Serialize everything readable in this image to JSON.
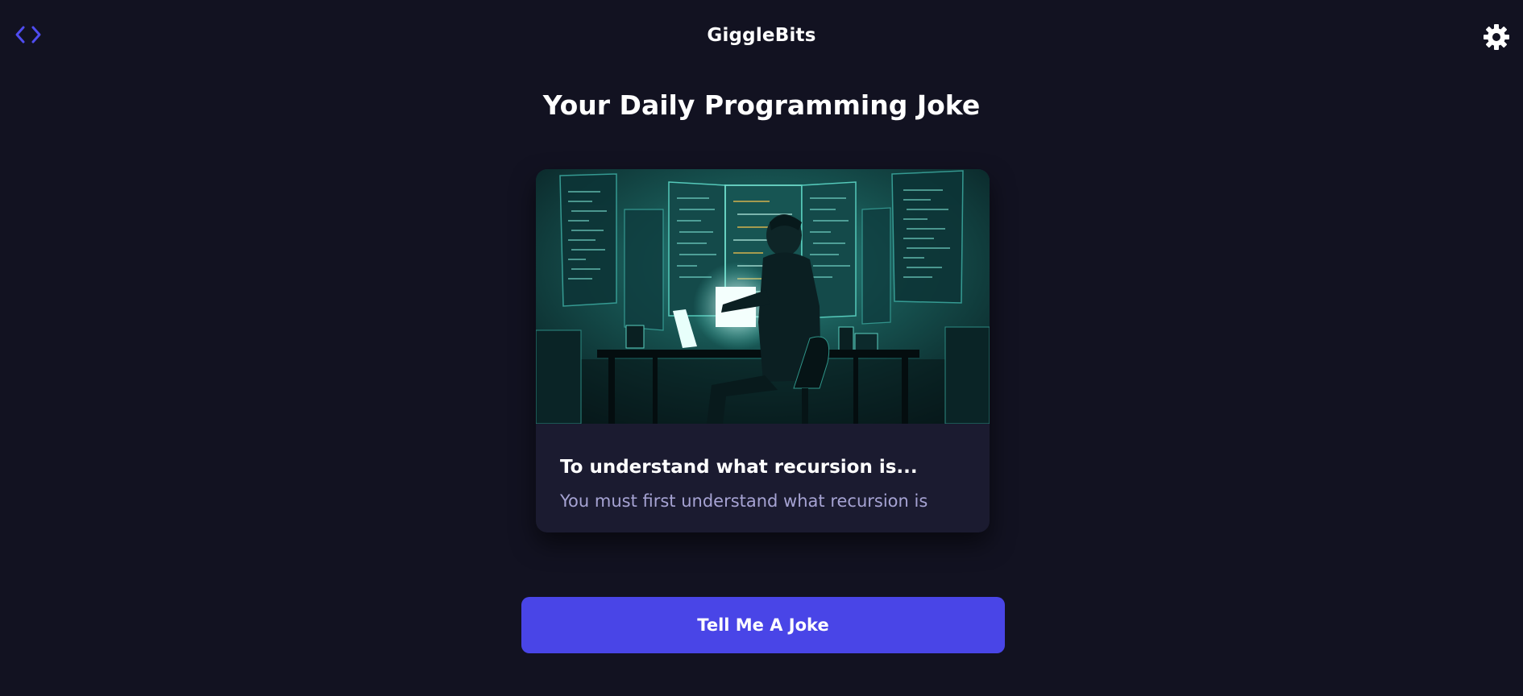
{
  "header": {
    "app_title": "GiggleBits",
    "left_icon": "code-icon",
    "right_icon": "gear-icon"
  },
  "page": {
    "title": "Your Daily Programming Joke"
  },
  "card": {
    "image_alt": "programmer at desk illustration",
    "setup": "To understand what recursion is...",
    "punchline": "You must first understand what recursion is"
  },
  "actions": {
    "joke_button_label": "Tell Me A Joke"
  },
  "colors": {
    "background": "#121221",
    "card": "#1b1b30",
    "accent": "#4945e7",
    "punchline_text": "#a6a3d3",
    "illustration_glow": "#38c9b8"
  }
}
